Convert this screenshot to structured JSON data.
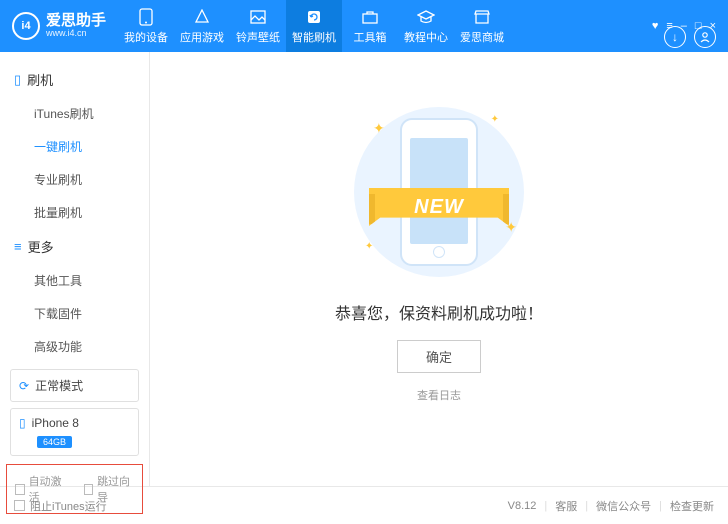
{
  "header": {
    "logo_title": "爱思助手",
    "logo_sub": "www.i4.cn",
    "nav": [
      {
        "label": "我的设备"
      },
      {
        "label": "应用游戏"
      },
      {
        "label": "铃声壁纸"
      },
      {
        "label": "智能刷机"
      },
      {
        "label": "工具箱"
      },
      {
        "label": "教程中心"
      },
      {
        "label": "爱思商城"
      }
    ]
  },
  "sidebar": {
    "section1_title": "刷机",
    "items1": [
      "iTunes刷机",
      "一键刷机",
      "专业刷机",
      "批量刷机"
    ],
    "section2_title": "更多",
    "items2": [
      "其他工具",
      "下载固件",
      "高级功能"
    ],
    "mode_label": "正常模式",
    "device_name": "iPhone 8",
    "device_badge": "64GB",
    "chk_auto": "自动激活",
    "chk_skip": "跳过向导"
  },
  "main": {
    "ribbon": "NEW",
    "message": "恭喜您，保资料刷机成功啦！",
    "ok": "确定",
    "log": "查看日志"
  },
  "footer": {
    "block_itunes": "阻止iTunes运行",
    "version": "V8.12",
    "support": "客服",
    "wechat": "微信公众号",
    "update": "检查更新"
  }
}
